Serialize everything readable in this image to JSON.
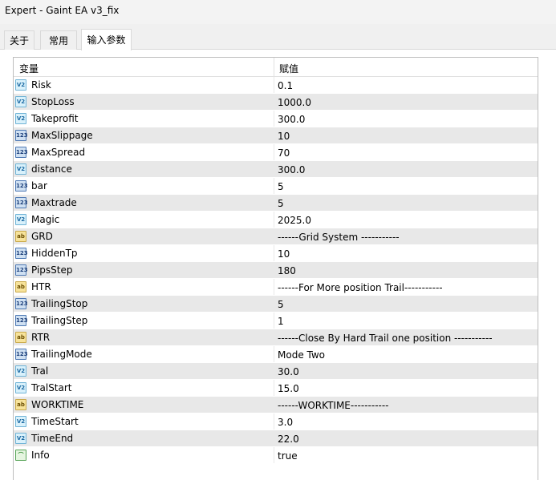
{
  "window": {
    "title": "Expert - Gaint EA v3_fix"
  },
  "tabs": [
    "关于",
    "常用",
    "输入参数"
  ],
  "grid": {
    "headers": {
      "variable": "变量",
      "value": "赋值"
    },
    "rows": [
      {
        "name": "Risk",
        "value": "0.1",
        "icon": "double",
        "icon_text": "V2"
      },
      {
        "name": "StopLoss",
        "value": "1000.0",
        "icon": "double",
        "icon_text": "V2"
      },
      {
        "name": "Takeprofit",
        "value": "300.0",
        "icon": "double",
        "icon_text": "V2"
      },
      {
        "name": "MaxSlippage",
        "value": "10",
        "icon": "int",
        "icon_text": "123"
      },
      {
        "name": "MaxSpread",
        "value": "70",
        "icon": "int",
        "icon_text": "123"
      },
      {
        "name": "distance",
        "value": "300.0",
        "icon": "double",
        "icon_text": "V2"
      },
      {
        "name": "bar",
        "value": "5",
        "icon": "int",
        "icon_text": "123"
      },
      {
        "name": "Maxtrade",
        "value": "5",
        "icon": "int",
        "icon_text": "123"
      },
      {
        "name": "Magic",
        "value": "2025.0",
        "icon": "double",
        "icon_text": "V2"
      },
      {
        "name": "GRD",
        "value": "------Grid System -----------",
        "icon": "string",
        "icon_text": "ab"
      },
      {
        "name": "HiddenTp",
        "value": "10",
        "icon": "int",
        "icon_text": "123"
      },
      {
        "name": "PipsStep",
        "value": "180",
        "icon": "int",
        "icon_text": "123"
      },
      {
        "name": "HTR",
        "value": "------For More position Trail-----------",
        "icon": "string",
        "icon_text": "ab"
      },
      {
        "name": "TrailingStop",
        "value": "5",
        "icon": "int",
        "icon_text": "123"
      },
      {
        "name": "TrailingStep",
        "value": "1",
        "icon": "int",
        "icon_text": "123"
      },
      {
        "name": "RTR",
        "value": "------Close By Hard Trail one position -----------",
        "icon": "string",
        "icon_text": "ab"
      },
      {
        "name": "TrailingMode",
        "value": "Mode Two",
        "icon": "int",
        "icon_text": "123"
      },
      {
        "name": "Tral",
        "value": "30.0",
        "icon": "double",
        "icon_text": "V2"
      },
      {
        "name": "TralStart",
        "value": "15.0",
        "icon": "double",
        "icon_text": "V2"
      },
      {
        "name": "WORKTIME",
        "value": "------WORKTIME-----------",
        "icon": "string",
        "icon_text": "ab"
      },
      {
        "name": "TimeStart",
        "value": "3.0",
        "icon": "double",
        "icon_text": "V2"
      },
      {
        "name": "TimeEnd",
        "value": "22.0",
        "icon": "double",
        "icon_text": "V2"
      },
      {
        "name": "Info",
        "value": "true",
        "icon": "bool",
        "icon_text": "⌒"
      }
    ]
  }
}
